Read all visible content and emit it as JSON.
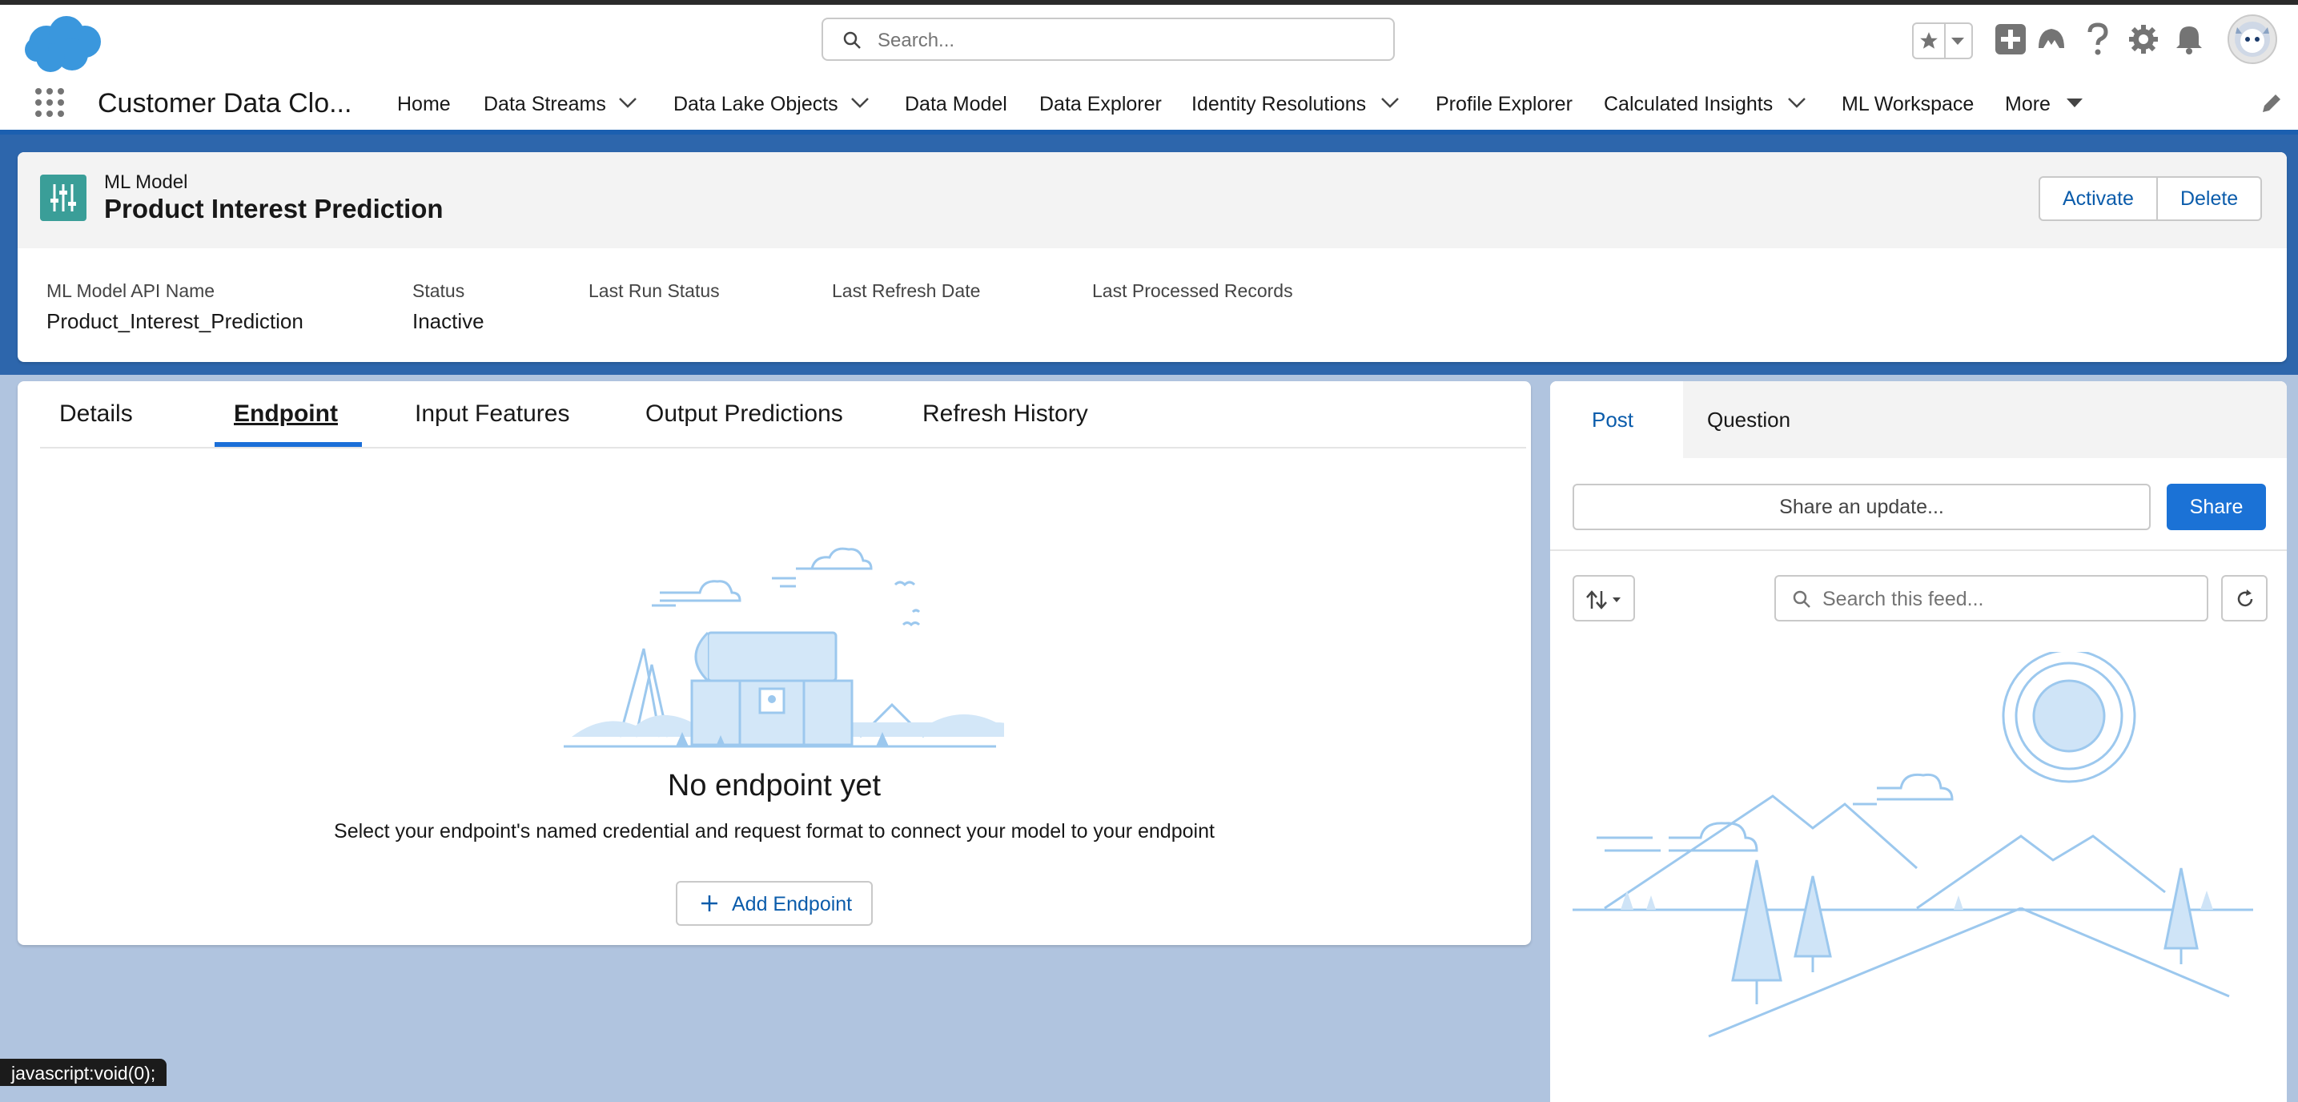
{
  "header": {
    "search_placeholder": "Search...",
    "icons": [
      "favorites-star-icon",
      "favorites-menu-icon",
      "global-actions-plus-icon",
      "trailhead-icon",
      "help-icon",
      "setup-gear-icon",
      "notifications-bell-icon",
      "user-avatar"
    ]
  },
  "nav": {
    "app_name": "Customer Data Clo...",
    "items": [
      {
        "label": "Home"
      },
      {
        "label": "Data Streams"
      },
      {
        "label": "Data Lake Objects"
      },
      {
        "label": "Data Model"
      },
      {
        "label": "Data Explorer"
      },
      {
        "label": "Identity Resolutions"
      },
      {
        "label": "Profile Explorer"
      },
      {
        "label": "Calculated Insights"
      },
      {
        "label": "ML Workspace"
      },
      {
        "label": "More"
      }
    ]
  },
  "record": {
    "object_type": "ML Model",
    "title": "Product Interest Prediction",
    "actions": {
      "activate": "Activate",
      "delete": "Delete"
    },
    "fields": [
      {
        "label": "ML Model API Name",
        "value": "Product_Interest_Prediction"
      },
      {
        "label": "Status",
        "value": "Inactive"
      },
      {
        "label": "Last Run Status",
        "value": ""
      },
      {
        "label": "Last Refresh Date",
        "value": ""
      },
      {
        "label": "Last Processed Records",
        "value": ""
      }
    ]
  },
  "tabs": [
    {
      "label": "Details"
    },
    {
      "label": "Endpoint"
    },
    {
      "label": "Input Features"
    },
    {
      "label": "Output Predictions"
    },
    {
      "label": "Refresh History"
    }
  ],
  "empty_state": {
    "title": "No endpoint yet",
    "description": "Select your endpoint's named credential and request format to connect your model to your endpoint",
    "button": "Add Endpoint"
  },
  "feed": {
    "tabs": {
      "post": "Post",
      "question": "Question"
    },
    "share_placeholder": "Share an update...",
    "share_button": "Share",
    "search_placeholder": "Search this feed..."
  },
  "statusbar": {
    "text": "javascript:void(0);"
  }
}
